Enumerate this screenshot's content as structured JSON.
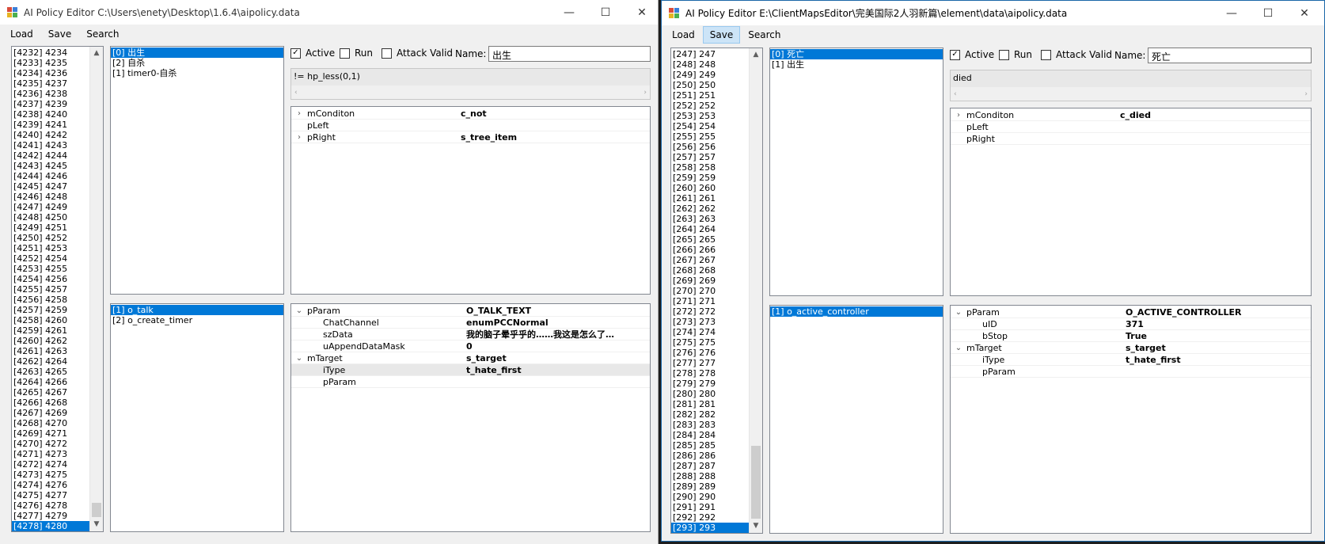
{
  "left": {
    "title": "AI Policy Editor  C:\\Users\\enety\\Desktop\\1.6.4\\aipolicy.data",
    "menu": [
      {
        "label": "Load"
      },
      {
        "label": "Save"
      },
      {
        "label": "Search"
      }
    ],
    "ids": [
      "[4232] 4234",
      "[4233] 4235",
      "[4234] 4236",
      "[4235] 4237",
      "[4236] 4238",
      "[4237] 4239",
      "[4238] 4240",
      "[4239] 4241",
      "[4240] 4242",
      "[4241] 4243",
      "[4242] 4244",
      "[4243] 4245",
      "[4244] 4246",
      "[4245] 4247",
      "[4246] 4248",
      "[4247] 4249",
      "[4248] 4250",
      "[4249] 4251",
      "[4250] 4252",
      "[4251] 4253",
      "[4252] 4254",
      "[4253] 4255",
      "[4254] 4256",
      "[4255] 4257",
      "[4256] 4258",
      "[4257] 4259",
      "[4258] 4260",
      "[4259] 4261",
      "[4260] 4262",
      "[4261] 4263",
      "[4262] 4264",
      "[4263] 4265",
      "[4264] 4266",
      "[4265] 4267",
      "[4266] 4268",
      "[4267] 4269",
      "[4268] 4270",
      "[4269] 4271",
      "[4270] 4272",
      "[4271] 4273",
      "[4272] 4274",
      "[4273] 4275",
      "[4274] 4276",
      "[4275] 4277",
      "[4276] 4278",
      "[4277] 4279",
      "[4278] 4280"
    ],
    "triggers": [
      "[0] 出生",
      "[2] 自杀",
      "[1] timer0-自杀"
    ],
    "active_label": "Active",
    "run_label": "Run",
    "attack_label": "Attack Valid",
    "name_label": "Name:",
    "name_value": "出生",
    "expression": "!= hp_less(0,1)",
    "conditions": [
      {
        "exp": "›",
        "name": "mConditon",
        "value": "c_not"
      },
      {
        "exp": "",
        "name": "pLeft",
        "value": ""
      },
      {
        "exp": "›",
        "name": "pRight",
        "value": "s_tree_item"
      }
    ],
    "operations": [
      "[1] o_talk",
      "[2] o_create_timer"
    ],
    "op_props": [
      {
        "exp": "⌄",
        "name": "pParam",
        "value": "O_TALK_TEXT",
        "indent": 0
      },
      {
        "exp": "",
        "name": "ChatChannel",
        "value": "enumPCCNormal",
        "indent": 1
      },
      {
        "exp": "",
        "name": "szData",
        "value": "我的脑子晕乎乎的……我这是怎么了…",
        "indent": 1
      },
      {
        "exp": "",
        "name": "uAppendDataMask",
        "value": "0",
        "indent": 1
      },
      {
        "exp": "⌄",
        "name": "mTarget",
        "value": "s_target",
        "indent": 0
      },
      {
        "exp": "",
        "name": "iType",
        "value": "t_hate_first",
        "indent": 1
      },
      {
        "exp": "",
        "name": "pParam",
        "value": "",
        "indent": 1
      }
    ]
  },
  "right": {
    "title": "AI Policy Editor  E:\\ClientMapsEditor\\完美国际2人羽新篇\\element\\data\\aipolicy.data",
    "menu": [
      {
        "label": "Load"
      },
      {
        "label": "Save"
      },
      {
        "label": "Search"
      }
    ],
    "ids": [
      "[247] 247",
      "[248] 248",
      "[249] 249",
      "[250] 250",
      "[251] 251",
      "[252] 252",
      "[253] 253",
      "[254] 254",
      "[255] 255",
      "[256] 256",
      "[257] 257",
      "[258] 258",
      "[259] 259",
      "[260] 260",
      "[261] 261",
      "[262] 262",
      "[263] 263",
      "[264] 264",
      "[265] 265",
      "[266] 266",
      "[267] 267",
      "[268] 268",
      "[269] 269",
      "[270] 270",
      "[271] 271",
      "[272] 272",
      "[273] 273",
      "[274] 274",
      "[275] 275",
      "[276] 276",
      "[277] 277",
      "[278] 278",
      "[279] 279",
      "[280] 280",
      "[281] 281",
      "[282] 282",
      "[283] 283",
      "[284] 284",
      "[285] 285",
      "[286] 286",
      "[287] 287",
      "[288] 288",
      "[289] 289",
      "[290] 290",
      "[291] 291",
      "[292] 292",
      "[293] 293"
    ],
    "triggers": [
      "[0] 死亡",
      "[1] 出生"
    ],
    "active_label": "Active",
    "run_label": "Run",
    "attack_label": "Attack Valid",
    "name_label": "Name:",
    "name_value": "死亡",
    "expression": "died",
    "conditions": [
      {
        "exp": "›",
        "name": "mConditon",
        "value": "c_died"
      },
      {
        "exp": "",
        "name": "pLeft",
        "value": ""
      },
      {
        "exp": "",
        "name": "pRight",
        "value": ""
      }
    ],
    "operations": [
      "[1] o_active_controller"
    ],
    "op_props": [
      {
        "exp": "⌄",
        "name": "pParam",
        "value": "O_ACTIVE_CONTROLLER",
        "indent": 0
      },
      {
        "exp": "",
        "name": "uID",
        "value": "371",
        "indent": 1
      },
      {
        "exp": "",
        "name": "bStop",
        "value": "True",
        "indent": 1
      },
      {
        "exp": "⌄",
        "name": "mTarget",
        "value": "s_target",
        "indent": 0
      },
      {
        "exp": "",
        "name": "iType",
        "value": "t_hate_first",
        "indent": 1
      },
      {
        "exp": "",
        "name": "pParam",
        "value": "",
        "indent": 1
      }
    ]
  },
  "window_controls": {
    "minimize": "—",
    "maximize": "☐",
    "close": "✕"
  },
  "icons": {
    "check": "✓",
    "scroll_up": "▲",
    "scroll_down": "▼",
    "scroll_left": "‹",
    "scroll_right": "›"
  }
}
